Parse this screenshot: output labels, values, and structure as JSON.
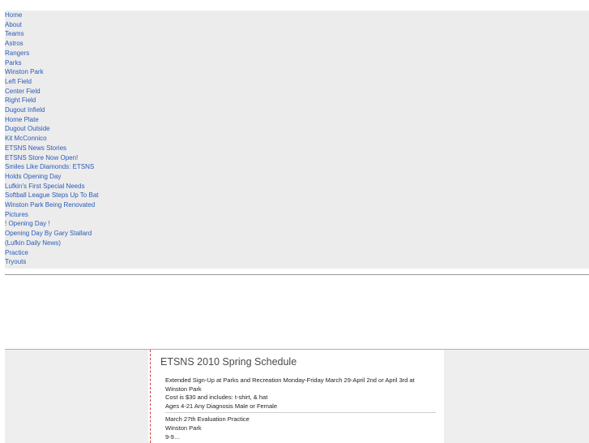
{
  "nav": {
    "items": [
      {
        "label": "Home"
      },
      {
        "label": "About"
      },
      {
        "label": "Teams",
        "children": [
          {
            "label": "Astros"
          },
          {
            "label": "Rangers"
          }
        ]
      },
      {
        "label": "Parks",
        "children": [
          {
            "label": "Winston Park",
            "children": [
              {
                "label": "Left Field"
              },
              {
                "label": "Center Field"
              },
              {
                "label": "Right Field"
              },
              {
                "label": "Dugout Infield"
              },
              {
                "label": "Home Plate"
              },
              {
                "label": "Dugout Outside"
              }
            ]
          },
          {
            "label": "Kit McConnico"
          }
        ]
      },
      {
        "label": "ETSNS News Stories",
        "children": [
          {
            "label": "ETSNS Store Now Open!"
          },
          {
            "label": "Smiles Like Diamonds: ETSNS Holds Opening Day"
          },
          {
            "label": "Lufkin’s First Special Needs Softball League Steps Up To Bat"
          },
          {
            "label": "Winston Park Being Renovated"
          }
        ]
      },
      {
        "label": "Pictures",
        "children": [
          {
            "label": "! Opening Day !"
          },
          {
            "label": "Opening Day By Gary Stallard (Lufkin Daily News)"
          },
          {
            "label": "Practice"
          },
          {
            "label": "Tryouts"
          }
        ]
      }
    ]
  },
  "content": {
    "title": "ETSNS 2010 Spring Schedule",
    "block1": {
      "line1": "Extended Sign-Up at Parks and Recreation Monday-Friday March 29-April 2nd or April 3rd at Winston Park",
      "line2": "Cost is $30 and includes: t-shirt, & hat",
      "line3": "Ages 4-21 Any Diagnosis Male or Female"
    },
    "block2": {
      "line1": "March 27th Evaluation Practice",
      "line2": "Winston Park",
      "line3": "9-9…"
    }
  }
}
